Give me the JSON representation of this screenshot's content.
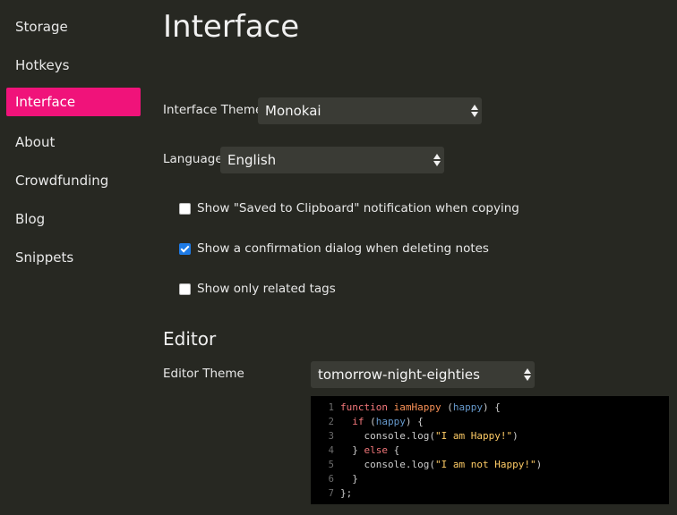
{
  "sidebar": {
    "items": [
      {
        "label": "Storage"
      },
      {
        "label": "Hotkeys"
      },
      {
        "label": "Interface",
        "active": true
      },
      {
        "label": "About"
      },
      {
        "label": "Crowdfunding"
      },
      {
        "label": "Blog"
      },
      {
        "label": "Snippets"
      }
    ]
  },
  "main": {
    "title": "Interface",
    "interface_theme": {
      "label": "Interface Theme",
      "value": "Monokai"
    },
    "language": {
      "label": "Language",
      "value": "English"
    },
    "checkboxes": [
      {
        "label": "Show \"Saved to Clipboard\" notification when copying",
        "checked": false
      },
      {
        "label": "Show a confirmation dialog when deleting notes",
        "checked": true
      },
      {
        "label": "Show only related tags",
        "checked": false
      }
    ],
    "editor": {
      "title": "Editor",
      "theme_label": "Editor Theme",
      "theme_value": "tomorrow-night-eighties"
    },
    "code_preview": {
      "lines": [
        {
          "n": "1",
          "t": "function iamHappy (happy) {"
        },
        {
          "n": "2",
          "t": "  if (happy) {"
        },
        {
          "n": "3",
          "t": "    console.log(\"I am Happy!\")"
        },
        {
          "n": "4",
          "t": "  } else {"
        },
        {
          "n": "5",
          "t": "    console.log(\"I am not Happy!\")"
        },
        {
          "n": "6",
          "t": "  }"
        },
        {
          "n": "7",
          "t": "};"
        }
      ]
    }
  },
  "colors": {
    "accent": "#f0137a",
    "background": "#272822",
    "checkbox_checked": "#1e7be6"
  }
}
